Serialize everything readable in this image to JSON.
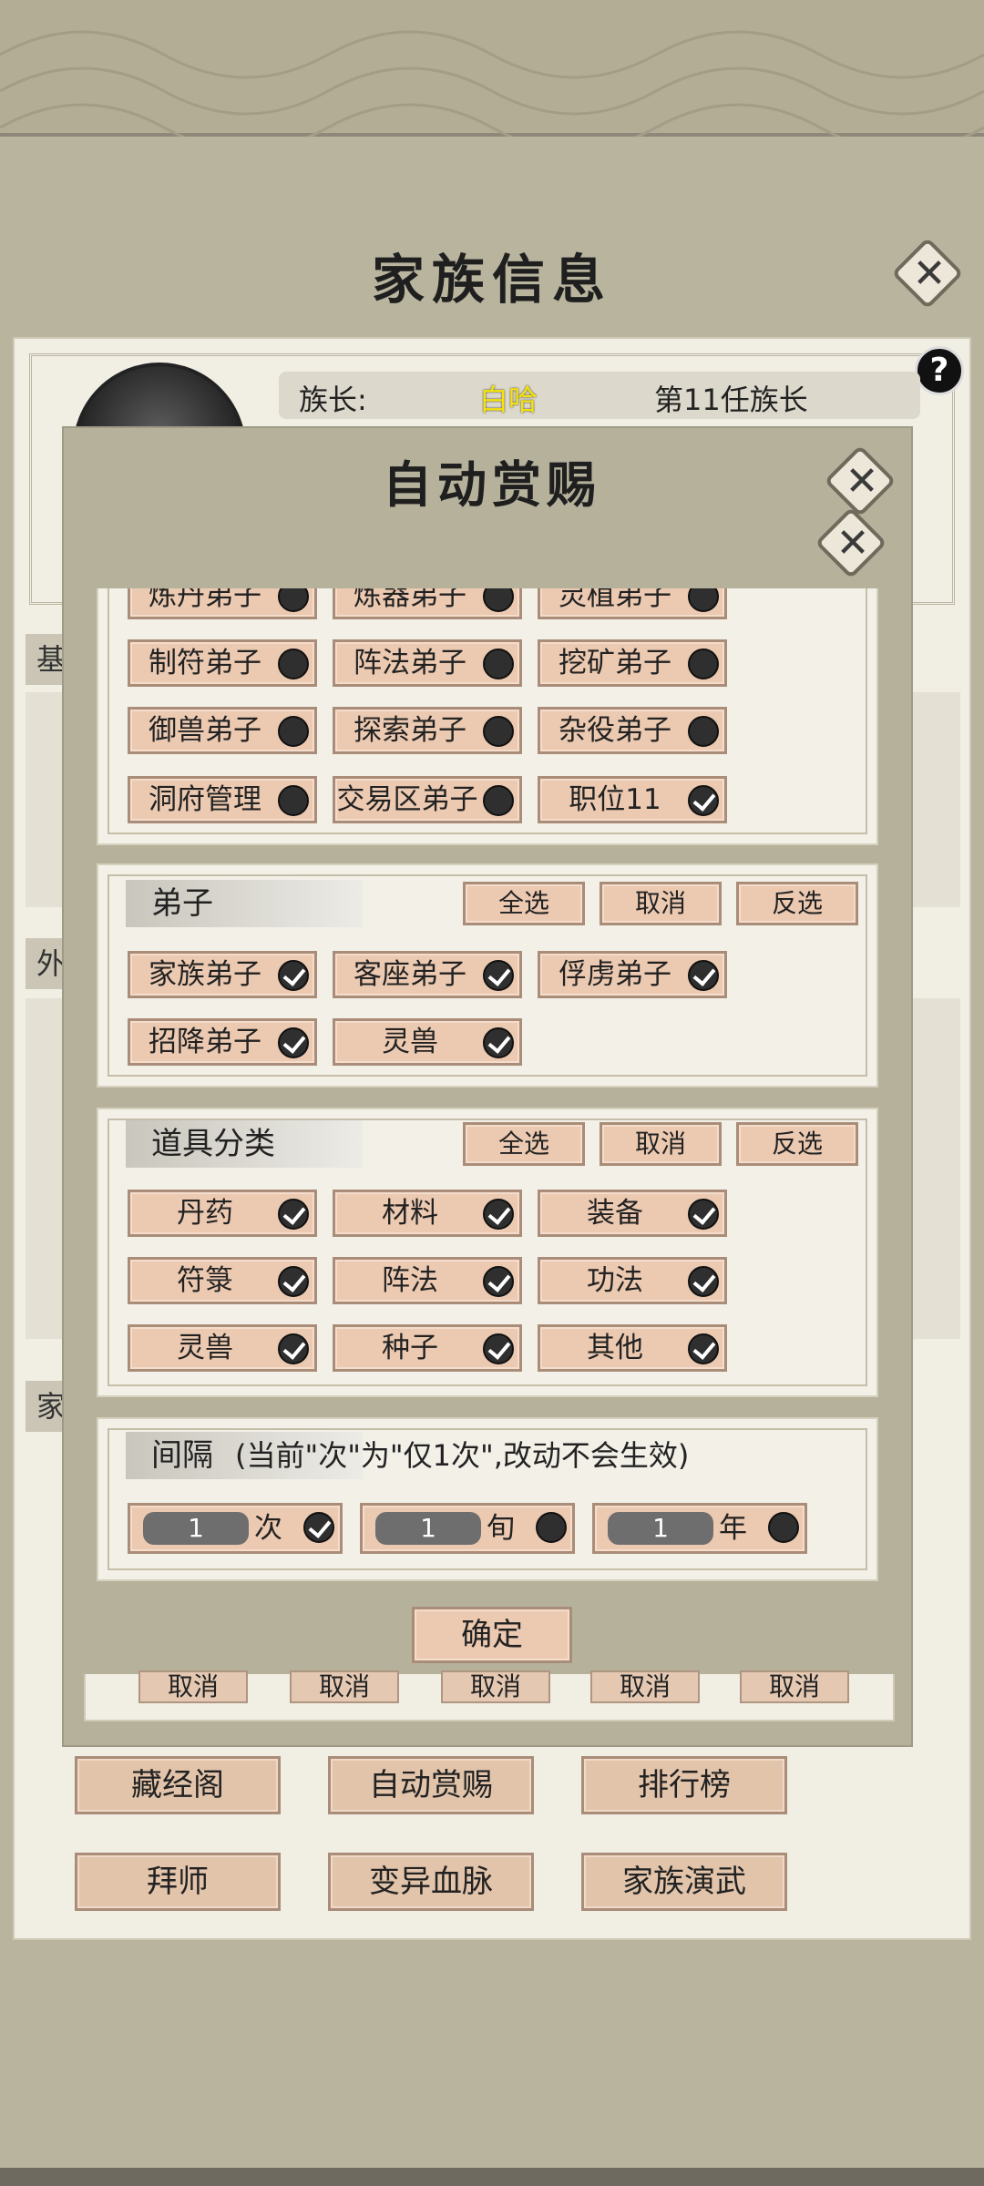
{
  "page_title": "家族信息",
  "leader": {
    "label": "族长:",
    "name": "白哈",
    "rank": "第11任族长"
  },
  "side_tabs": [
    "基",
    "外",
    "家"
  ],
  "background_cancel_label": "取消",
  "bottom_buttons": [
    "藏经阁",
    "自动赏赐",
    "排行榜",
    "拜师",
    "变异血脉",
    "家族演武"
  ],
  "dialog": {
    "title": "自动赏赐",
    "positions": [
      {
        "label": "炼丹弟子",
        "checked": false
      },
      {
        "label": "炼器弟子",
        "checked": false
      },
      {
        "label": "灵植弟子",
        "checked": false
      },
      {
        "label": "制符弟子",
        "checked": false
      },
      {
        "label": "阵法弟子",
        "checked": false
      },
      {
        "label": "挖矿弟子",
        "checked": false
      },
      {
        "label": "御兽弟子",
        "checked": false
      },
      {
        "label": "探索弟子",
        "checked": false
      },
      {
        "label": "杂役弟子",
        "checked": false
      },
      {
        "label": "洞府管理",
        "checked": false
      },
      {
        "label": "交易区弟子",
        "checked": false
      },
      {
        "label": "职位11",
        "checked": true
      }
    ],
    "disciples": {
      "title": "弟子",
      "select_all": "全选",
      "cancel": "取消",
      "invert": "反选",
      "options": [
        {
          "label": "家族弟子",
          "checked": true
        },
        {
          "label": "客座弟子",
          "checked": true
        },
        {
          "label": "俘虏弟子",
          "checked": true
        },
        {
          "label": "招降弟子",
          "checked": true
        },
        {
          "label": "灵兽",
          "checked": true
        }
      ]
    },
    "items": {
      "title": "道具分类",
      "select_all": "全选",
      "cancel": "取消",
      "invert": "反选",
      "options": [
        {
          "label": "丹药",
          "checked": true
        },
        {
          "label": "材料",
          "checked": true
        },
        {
          "label": "装备",
          "checked": true
        },
        {
          "label": "符箓",
          "checked": true
        },
        {
          "label": "阵法",
          "checked": true
        },
        {
          "label": "功法",
          "checked": true
        },
        {
          "label": "灵兽",
          "checked": true
        },
        {
          "label": "种子",
          "checked": true
        },
        {
          "label": "其他",
          "checked": true
        }
      ]
    },
    "interval": {
      "title": "间隔",
      "note": "(当前\"次\"为\"仅1次\",改动不会生效)",
      "options": [
        {
          "value": "1",
          "unit": "次",
          "checked": true
        },
        {
          "value": "1",
          "unit": "旬",
          "checked": false
        },
        {
          "value": "1",
          "unit": "年",
          "checked": false
        }
      ]
    },
    "confirm": "确定"
  }
}
